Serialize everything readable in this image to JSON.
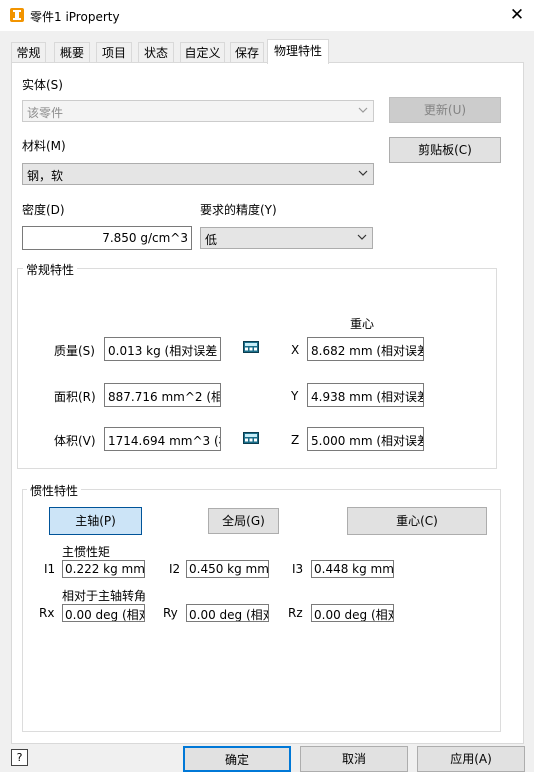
{
  "window": {
    "title": "零件1 iProperty",
    "close": "✕"
  },
  "tabs": [
    {
      "label": "常规",
      "active": false
    },
    {
      "label": "概要",
      "active": false
    },
    {
      "label": "项目",
      "active": false
    },
    {
      "label": "状态",
      "active": false
    },
    {
      "label": "自定义",
      "active": false
    },
    {
      "label": "保存",
      "active": false
    },
    {
      "label": "物理特性",
      "active": true
    }
  ],
  "solid": {
    "label": "实体(S)",
    "value": "该零件"
  },
  "material": {
    "label": "材料(M)",
    "value": "钢，软"
  },
  "buttons": {
    "update": "更新(U)",
    "clipboard": "剪贴板(C)"
  },
  "density": {
    "label": "密度(D)",
    "value": "7.850 g/cm^3"
  },
  "accuracy": {
    "label": "要求的精度(Y)",
    "value": "低"
  },
  "general": {
    "title": "常规特性",
    "cog_title": "重心",
    "mass": {
      "label": "质量(S)",
      "value": "0.013 kg (相对误差 ="
    },
    "area": {
      "label": "面积(R)",
      "value": "887.716 mm^2 (相对"
    },
    "volume": {
      "label": "体积(V)",
      "value": "1714.694 mm^3 (相"
    },
    "x": {
      "label": "X",
      "value": "8.682 mm (相对误差"
    },
    "y": {
      "label": "Y",
      "value": "4.938 mm (相对误差"
    },
    "z": {
      "label": "Z",
      "value": "5.000 mm (相对误差"
    }
  },
  "inertial": {
    "title": "惯性特性",
    "btn_principal": "主轴(P)",
    "btn_global": "全局(G)",
    "btn_cog": "重心(C)",
    "principal_moments_label": "主惯性矩",
    "i1": {
      "label": "I1",
      "value": "0.222 kg mm^"
    },
    "i2": {
      "label": "I2",
      "value": "0.450 kg mm^"
    },
    "i3": {
      "label": "I3",
      "value": "0.448 kg mm^"
    },
    "rotation_label": "相对于主轴转角",
    "rx": {
      "label": "Rx",
      "value": "0.00 deg (相对"
    },
    "ry": {
      "label": "Ry",
      "value": "0.00 deg (相对"
    },
    "rz": {
      "label": "Rz",
      "value": "0.00 deg (相对"
    }
  },
  "footer": {
    "help": "?",
    "ok": "确定",
    "cancel": "取消",
    "apply": "应用(A)"
  },
  "colors": {
    "accent_border": "#005499",
    "pressed_bg": "#cce4f7",
    "icon_orange": "#f29400"
  }
}
